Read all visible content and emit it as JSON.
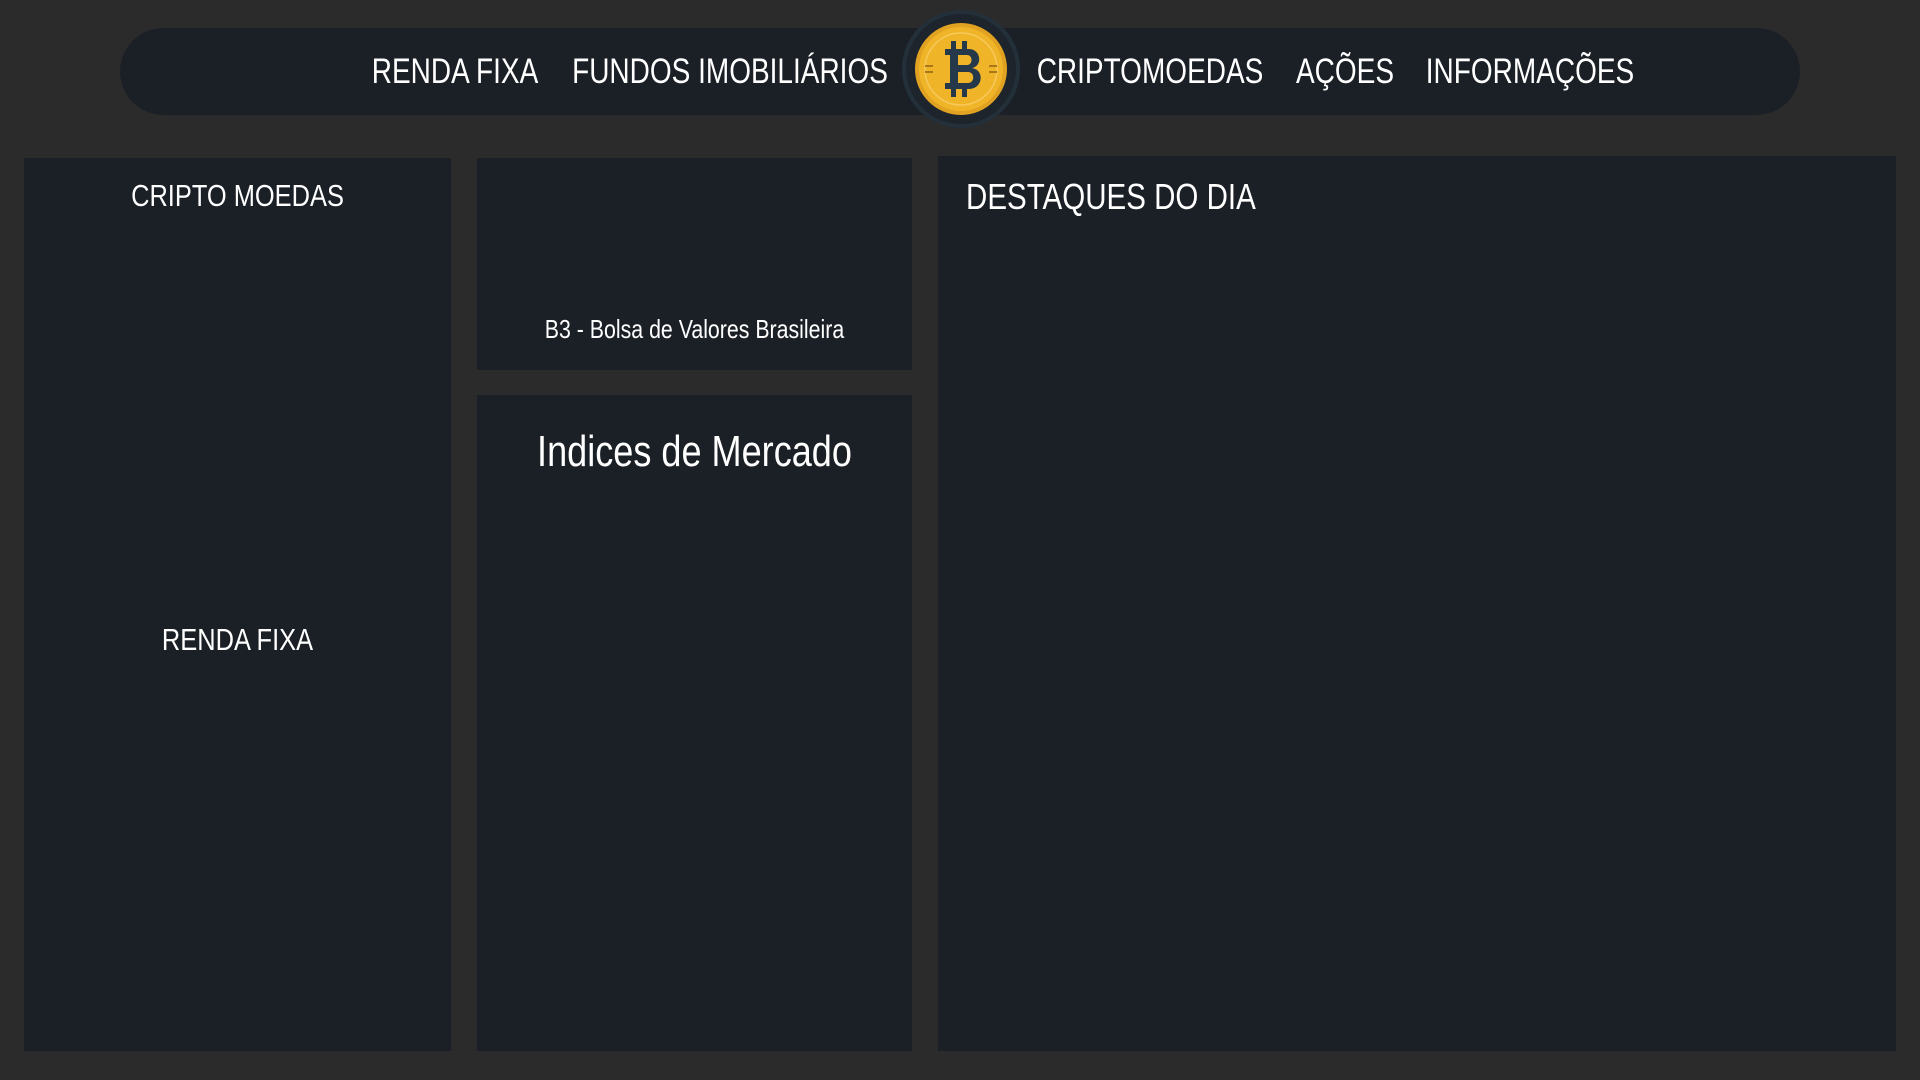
{
  "nav": {
    "items": [
      {
        "label": "RENDA FIXA"
      },
      {
        "label": "FUNDOS IMOBILIÁRIOS"
      },
      {
        "label": "CRIPTOMOEDAS"
      },
      {
        "label": "AÇÕES"
      },
      {
        "label": "INFORMAÇÕES"
      }
    ],
    "logo_icon": "bitcoin-logo-icon"
  },
  "panels": {
    "crypto": {
      "title": "CRIPTO MOEDAS",
      "renda_fixa": "RENDA FIXA"
    },
    "b3": {
      "caption": "B3 - Bolsa de Valores Brasileira"
    },
    "indices": {
      "title": "Indices de Mercado"
    },
    "destaques": {
      "title": "DESTAQUES DO DIA"
    }
  },
  "colors": {
    "background": "#2b2b2b",
    "panel": "#1b2027",
    "logo_gold": "#f0b429",
    "logo_symbol": "#26394a"
  }
}
